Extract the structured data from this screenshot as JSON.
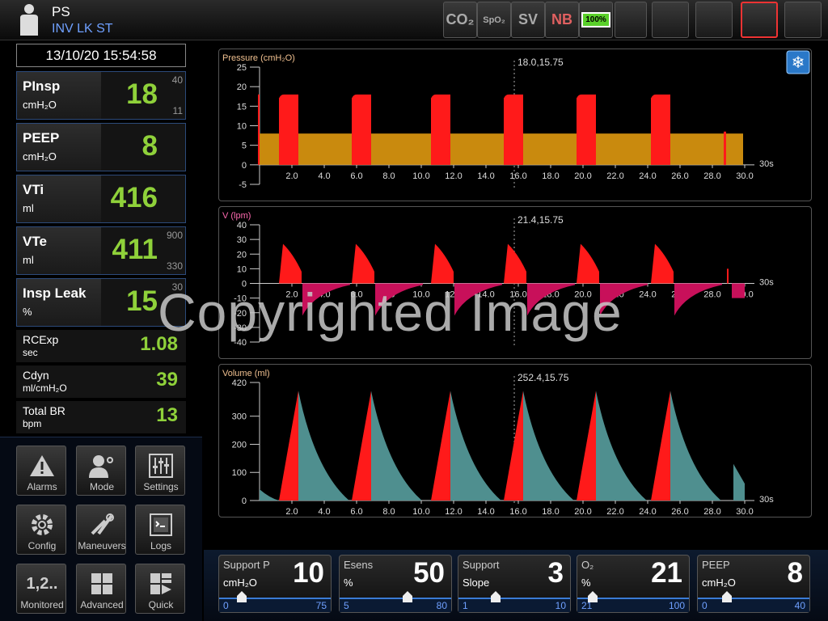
{
  "header": {
    "mode": "PS",
    "submode": "INV LK ST",
    "icons": [
      {
        "name": "co2-icon",
        "label": "CO₂"
      },
      {
        "name": "spo2-icon",
        "label": "SpO₂"
      },
      {
        "name": "sv-icon",
        "label": "SV"
      },
      {
        "name": "nb-icon",
        "label": "NB"
      },
      {
        "name": "battery-icon",
        "label": "100%"
      },
      {
        "name": "power-plug-icon",
        "label": ""
      },
      {
        "name": "lock-icon",
        "label": ""
      },
      {
        "name": "bell-icon",
        "label": ""
      },
      {
        "name": "standby-icon",
        "label": ""
      },
      {
        "name": "plus-icon",
        "label": ""
      }
    ]
  },
  "datetime": "13/10/20 15:54:58",
  "params": [
    {
      "name": "PInsp",
      "unit": "cmH₂O",
      "value": "18",
      "hi": "40",
      "lo": "11"
    },
    {
      "name": "PEEP",
      "unit": "cmH₂O",
      "value": "8",
      "hi": "",
      "lo": ""
    },
    {
      "name": "VTi",
      "unit": "ml",
      "value": "416",
      "hi": "",
      "lo": ""
    },
    {
      "name": "VTe",
      "unit": "ml",
      "value": "411",
      "hi": "900",
      "lo": "330"
    },
    {
      "name": "Insp Leak",
      "unit": "%",
      "value": "15",
      "hi": "30",
      "lo": ""
    }
  ],
  "small_params": [
    {
      "name": "RCExp",
      "unit": "sec",
      "value": "1.08"
    },
    {
      "name": "Cdyn",
      "unit": "ml/cmH₂O",
      "value": "39"
    },
    {
      "name": "Total BR",
      "unit": "bpm",
      "value": "13"
    }
  ],
  "menu": [
    {
      "label": "Alarms",
      "icon": "warning-icon",
      "glyph": "⚠"
    },
    {
      "label": "Mode",
      "icon": "patient-mode-icon",
      "glyph": "👤"
    },
    {
      "label": "Settings",
      "icon": "sliders-icon",
      "glyph": "☷"
    },
    {
      "label": "Config",
      "icon": "gear-icon",
      "glyph": "⚙"
    },
    {
      "label": "Maneuvers",
      "icon": "tools-icon",
      "glyph": "✂"
    },
    {
      "label": "Logs",
      "icon": "log-icon",
      "glyph": "▣"
    },
    {
      "label": "Monitored",
      "icon": "numbers-icon",
      "glyph": "1,2.."
    },
    {
      "label": "Advanced",
      "icon": "grid-icon",
      "glyph": "▦"
    },
    {
      "label": "Quick",
      "icon": "quick-grid-icon",
      "glyph": "▞"
    }
  ],
  "chart_data": [
    {
      "type": "area",
      "title": "Pressure (cmH₂O)",
      "cursor_readout": "18.0,15.75",
      "ylim": [
        -5,
        25
      ],
      "yticks": [
        "25",
        "20",
        "15",
        "10",
        "5",
        "0",
        "-5"
      ],
      "xticks": [
        "2.0",
        "4.0",
        "6.0",
        "8.0",
        "10.0",
        "12.0",
        "14.0",
        "16.0",
        "18.0",
        "20.0",
        "22.0",
        "24.0",
        "26.0",
        "28.0",
        "30.0"
      ],
      "xlim": [
        0,
        30
      ],
      "xunit_label": "30s",
      "breath_starts": [
        1.2,
        5.7,
        10.6,
        15.1,
        19.6,
        24.2
      ],
      "series": [
        {
          "name": "PInsp",
          "values": [
            18
          ],
          "color": "#ff1a1a"
        },
        {
          "name": "PEEP",
          "values": [
            8
          ],
          "color": "#c98a0e"
        }
      ]
    },
    {
      "type": "area",
      "title": "V (lpm)",
      "cursor_readout": "21.4,15.75",
      "ylim": [
        -40,
        40
      ],
      "yticks": [
        "40",
        "30",
        "20",
        "10",
        "0",
        "-10",
        "-20",
        "-30",
        "-40"
      ],
      "xticks": [
        "2.0",
        "4.0",
        "6.0",
        "8.0",
        "10.0",
        "12.0",
        "14.0",
        "16.0",
        "18.0",
        "20.0",
        "22.0",
        "24.0",
        "26.0",
        "28.0",
        "30.0"
      ],
      "xlim": [
        0,
        30
      ],
      "xunit_label": "30s",
      "breath_starts": [
        1.2,
        5.7,
        10.6,
        15.1,
        19.6,
        24.2
      ],
      "series": [
        {
          "name": "Insp",
          "values": [
            27
          ],
          "color": "#ff1a1a"
        },
        {
          "name": "Exp",
          "values": [
            -22
          ],
          "color": "#c8105a"
        }
      ]
    },
    {
      "type": "area",
      "title": "Volume (ml)",
      "cursor_readout": "252.4,15.75",
      "ylim": [
        0,
        420
      ],
      "yticks": [
        "420",
        "300",
        "200",
        "100",
        "0"
      ],
      "xticks": [
        "2.0",
        "4.0",
        "6.0",
        "8.0",
        "10.0",
        "12.0",
        "14.0",
        "16.0",
        "18.0",
        "20.0",
        "22.0",
        "24.0",
        "26.0",
        "28.0",
        "30.0"
      ],
      "xlim": [
        0,
        30
      ],
      "xunit_label": "30s",
      "breath_starts": [
        1.2,
        5.7,
        10.6,
        15.1,
        19.6,
        24.2
      ],
      "series": [
        {
          "name": "Insp",
          "values": [
            390
          ],
          "color": "#ff1a1a"
        },
        {
          "name": "Exp",
          "values": [
            390
          ],
          "color": "#4f8f8f"
        }
      ]
    }
  ],
  "settings": [
    {
      "name": "Support P",
      "unit": "cmH₂O",
      "value": "10",
      "min": "0",
      "max": "75",
      "pos": 0.13
    },
    {
      "name": "Esens",
      "unit": "%",
      "value": "50",
      "min": "5",
      "max": "80",
      "pos": 0.6
    },
    {
      "name": "Support",
      "unit": "Slope",
      "value": "3",
      "min": "1",
      "max": "10",
      "pos": 0.28
    },
    {
      "name": "O₂",
      "unit": "%",
      "value": "21",
      "min": "21",
      "max": "100",
      "pos": 0.06
    },
    {
      "name": "PEEP",
      "unit": "cmH₂O",
      "value": "8",
      "min": "0",
      "max": "40",
      "pos": 0.2
    }
  ],
  "watermark": "Copyrighted Image"
}
